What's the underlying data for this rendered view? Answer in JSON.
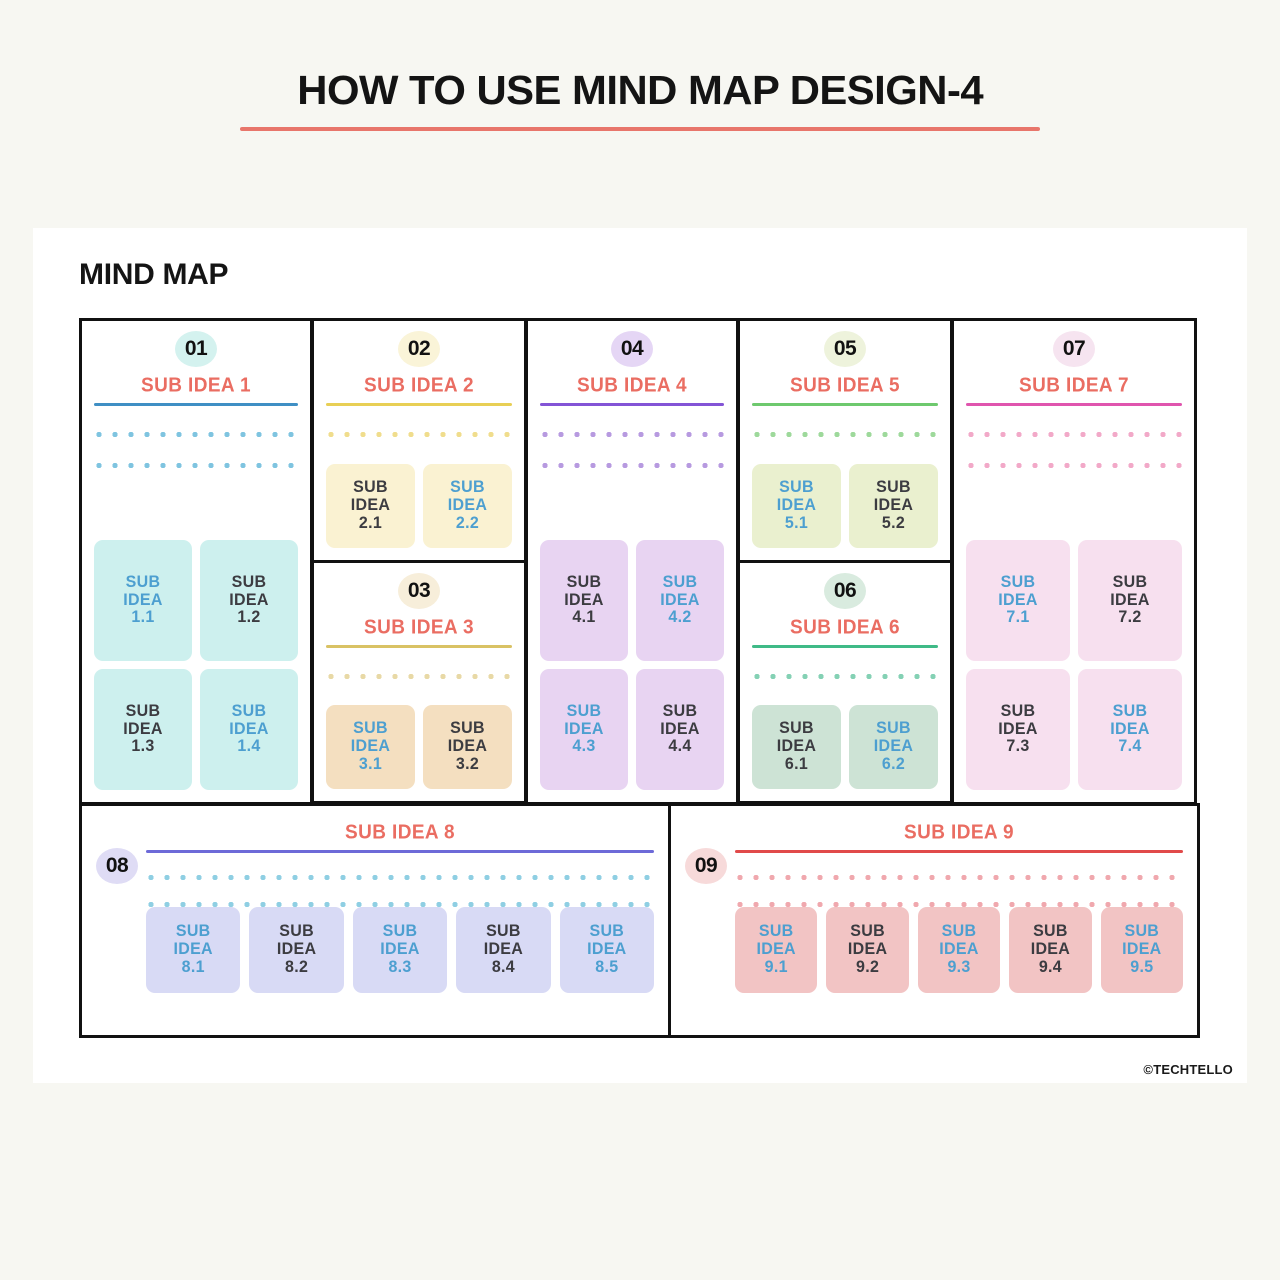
{
  "page": {
    "title": "HOW TO USE MIND MAP DESIGN-4",
    "panel_heading": "MIND MAP",
    "credit": "©TECHTELLO",
    "background": "#f7f7f2",
    "title_rule_color": "#e8766b",
    "heading_color": "#ea6d62"
  },
  "cards": [
    {
      "number": "01",
      "title": "SUB IDEA 1",
      "badge_bg": "#d4f2ef",
      "rule_color": "#3f8fc4",
      "dash_color": "#7fc4e0",
      "box_bg": "#cdf0ee",
      "dash_count": 2,
      "sub_ideas": [
        {
          "line1": "SUB",
          "line2": "IDEA",
          "line3": "1.1",
          "color": "blue"
        },
        {
          "line1": "SUB",
          "line2": "IDEA",
          "line3": "1.2",
          "color": "dark"
        },
        {
          "line1": "SUB",
          "line2": "IDEA",
          "line3": "1.3",
          "color": "dark"
        },
        {
          "line1": "SUB",
          "line2": "IDEA",
          "line3": "1.4",
          "color": "blue"
        }
      ]
    },
    {
      "number": "02",
      "title": "SUB IDEA 2",
      "badge_bg": "#faf4d8",
      "rule_color": "#e8cf55",
      "dash_color": "#f0dd8d",
      "box_bg": "#faf2d2",
      "dash_count": 1,
      "sub_ideas": [
        {
          "line1": "SUB",
          "line2": "IDEA",
          "line3": "2.1",
          "color": "dark"
        },
        {
          "line1": "SUB",
          "line2": "IDEA",
          "line3": "2.2",
          "color": "blue"
        }
      ]
    },
    {
      "number": "03",
      "title": "SUB IDEA 3",
      "badge_bg": "#f7eeda",
      "rule_color": "#d9c264",
      "dash_color": "#e8d9a6",
      "box_bg": "#f4dfc0",
      "dash_count": 1,
      "sub_ideas": [
        {
          "line1": "SUB",
          "line2": "IDEA",
          "line3": "3.1",
          "color": "blue"
        },
        {
          "line1": "SUB",
          "line2": "IDEA",
          "line3": "3.2",
          "color": "dark"
        }
      ]
    },
    {
      "number": "04",
      "title": "SUB IDEA 4",
      "badge_bg": "#e5d6f5",
      "rule_color": "#8354d6",
      "dash_color": "#b79ae0",
      "box_bg": "#e8d4f2",
      "dash_count": 2,
      "sub_ideas": [
        {
          "line1": "SUB",
          "line2": "IDEA",
          "line3": "4.1",
          "color": "dark"
        },
        {
          "line1": "SUB",
          "line2": "IDEA",
          "line3": "4.2",
          "color": "blue"
        },
        {
          "line1": "SUB",
          "line2": "IDEA",
          "line3": "4.3",
          "color": "blue"
        },
        {
          "line1": "SUB",
          "line2": "IDEA",
          "line3": "4.4",
          "color": "dark"
        }
      ]
    },
    {
      "number": "05",
      "title": "SUB IDEA 5",
      "badge_bg": "#eef3dc",
      "rule_color": "#6ec96e",
      "dash_color": "#9ed99b",
      "box_bg": "#eaf0cf",
      "dash_count": 1,
      "sub_ideas": [
        {
          "line1": "SUB",
          "line2": "IDEA",
          "line3": "5.1",
          "color": "blue"
        },
        {
          "line1": "SUB",
          "line2": "IDEA",
          "line3": "5.2",
          "color": "dark"
        }
      ]
    },
    {
      "number": "06",
      "title": "SUB IDEA 6",
      "badge_bg": "#d9ebdf",
      "rule_color": "#3fba87",
      "dash_color": "#84d1b4",
      "box_bg": "#cde3d5",
      "dash_count": 1,
      "sub_ideas": [
        {
          "line1": "SUB",
          "line2": "IDEA",
          "line3": "6.1",
          "color": "dark"
        },
        {
          "line1": "SUB",
          "line2": "IDEA",
          "line3": "6.2",
          "color": "blue"
        }
      ]
    },
    {
      "number": "07",
      "title": "SUB IDEA 7",
      "badge_bg": "#f6e4f0",
      "rule_color": "#e055ae",
      "dash_color": "#f2a9c8",
      "box_bg": "#f7e0ef",
      "dash_count": 2,
      "sub_ideas": [
        {
          "line1": "SUB",
          "line2": "IDEA",
          "line3": "7.1",
          "color": "blue"
        },
        {
          "line1": "SUB",
          "line2": "IDEA",
          "line3": "7.2",
          "color": "dark"
        },
        {
          "line1": "SUB",
          "line2": "IDEA",
          "line3": "7.3",
          "color": "dark"
        },
        {
          "line1": "SUB",
          "line2": "IDEA",
          "line3": "7.4",
          "color": "blue"
        }
      ]
    },
    {
      "number": "08",
      "title": "SUB IDEA 8",
      "badge_bg": "#dfdcf5",
      "rule_color": "#6d6ad8",
      "dash_color": "#8fcfe3",
      "box_bg": "#d8daf5",
      "dash_count": 2,
      "sub_ideas": [
        {
          "line1": "SUB",
          "line2": "IDEA",
          "line3": "8.1",
          "color": "blue"
        },
        {
          "line1": "SUB",
          "line2": "IDEA",
          "line3": "8.2",
          "color": "dark"
        },
        {
          "line1": "SUB",
          "line2": "IDEA",
          "line3": "8.3",
          "color": "blue"
        },
        {
          "line1": "SUB",
          "line2": "IDEA",
          "line3": "8.4",
          "color": "dark"
        },
        {
          "line1": "SUB",
          "line2": "IDEA",
          "line3": "8.5",
          "color": "blue"
        }
      ]
    },
    {
      "number": "09",
      "title": "SUB IDEA 9",
      "badge_bg": "#f7dada",
      "rule_color": "#e14a4a",
      "dash_color": "#f0a8ae",
      "box_bg": "#f2c4c4",
      "dash_count": 2,
      "sub_ideas": [
        {
          "line1": "SUB",
          "line2": "IDEA",
          "line3": "9.1",
          "color": "blue"
        },
        {
          "line1": "SUB",
          "line2": "IDEA",
          "line3": "9.2",
          "color": "dark"
        },
        {
          "line1": "SUB",
          "line2": "IDEA",
          "line3": "9.3",
          "color": "blue"
        },
        {
          "line1": "SUB",
          "line2": "IDEA",
          "line3": "9.4",
          "color": "dark"
        },
        {
          "line1": "SUB",
          "line2": "IDEA",
          "line3": "9.5",
          "color": "blue"
        }
      ]
    }
  ]
}
